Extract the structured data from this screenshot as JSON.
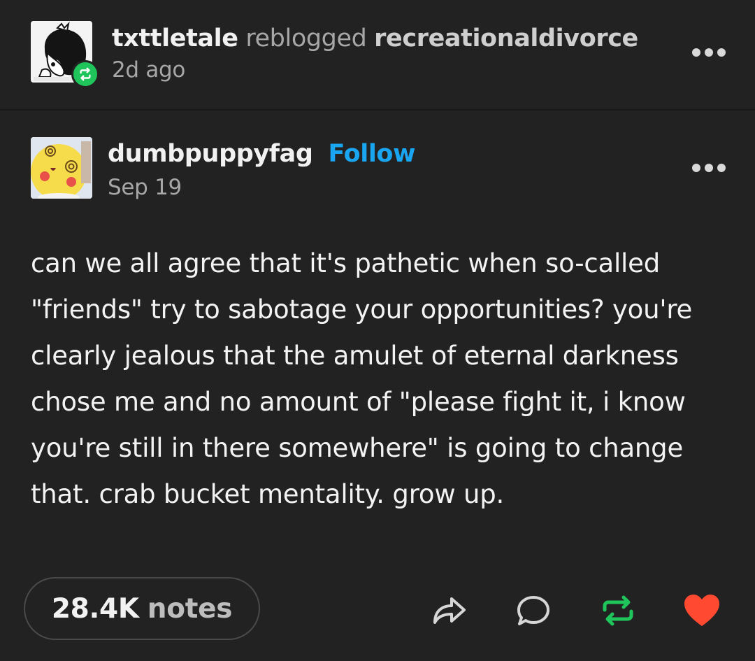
{
  "reblog": {
    "reblogger": "txttletale",
    "action": "reblogged",
    "source": "recreationaldivorce",
    "time": "2d ago"
  },
  "post": {
    "author": "dumbpuppyfag",
    "follow_label": "Follow",
    "date": "Sep 19",
    "body": "can we all agree that it's pathetic when so-called \"friends\" try to sabotage your opportunities? you're clearly jealous that the amulet of eternal darkness chose me and no amount of \"please fight it, i know you're still in there somewhere\" is going to change that. crab bucket mentality. grow up."
  },
  "footer": {
    "notes_count": "28.4K",
    "notes_label": "notes",
    "actions": [
      "share-icon",
      "reply-icon",
      "reblog-icon",
      "heart-icon"
    ]
  },
  "colors": {
    "background": "#222222",
    "follow": "#1aa5f0",
    "reblog_green": "#1fc45a",
    "heart_red": "#ff4930"
  }
}
